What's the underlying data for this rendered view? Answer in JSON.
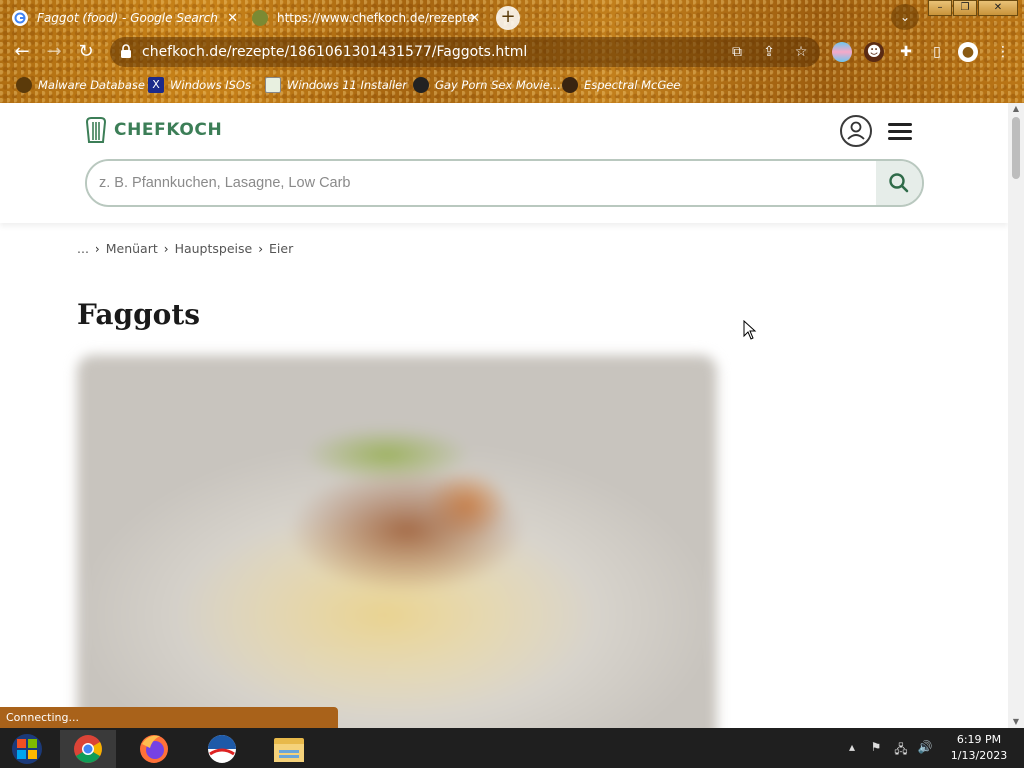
{
  "browser": {
    "tabs": [
      {
        "title": "Faggot (food) - Google Search",
        "active": false
      },
      {
        "title": "https://www.chefkoch.de/rezepte",
        "active": true
      }
    ],
    "new_tab_label": "+",
    "close_label": "✕",
    "url": "chefkoch.de/rezepte/1861061301431577/Faggots.html",
    "bookmarks": [
      {
        "label": "Malware Database"
      },
      {
        "label": "Windows ISOs"
      },
      {
        "label": "Windows 11 Installer"
      },
      {
        "label": "Gay Porn Sex Movie..."
      },
      {
        "label": "Espectral McGee"
      }
    ],
    "status_text": "Connecting..."
  },
  "site": {
    "logo_text": "CHEFKOCH",
    "search_placeholder": "z. B. Pfannkuchen, Lasagne, Low Carb",
    "breadcrumb": [
      "...",
      "Menüart",
      "Hauptspeise",
      "Eier"
    ],
    "recipe_title": "Faggots"
  },
  "taskbar": {
    "time": "6:19 PM",
    "date": "1/13/2023",
    "apps": [
      "start",
      "chrome",
      "firefox",
      "obama-logo",
      "file-explorer"
    ]
  },
  "colors": {
    "chefkoch_green": "#3c7e57",
    "theme_brown": "#b06e12"
  }
}
